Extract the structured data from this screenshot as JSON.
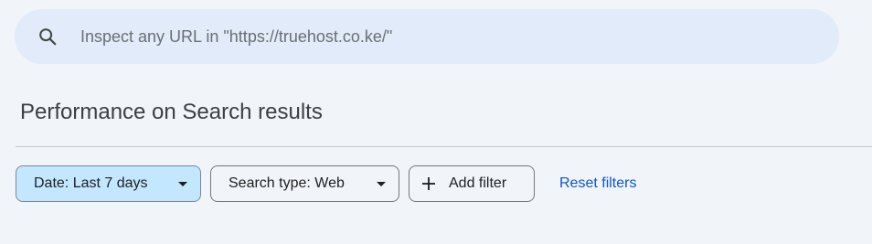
{
  "search": {
    "icon": "search-icon",
    "placeholder": "Inspect any URL in \"https://truehost.co.ke/\""
  },
  "page": {
    "title": "Performance on Search results"
  },
  "filters": {
    "date_label": "Date: Last 7 days",
    "search_type_label": "Search type: Web",
    "add_filter_label": "Add filter",
    "reset_label": "Reset filters"
  },
  "colors": {
    "background": "#f1f4f9",
    "search_bar": "#e2ebf9",
    "active_chip": "#c2e7ff",
    "link": "#0b57d0"
  }
}
